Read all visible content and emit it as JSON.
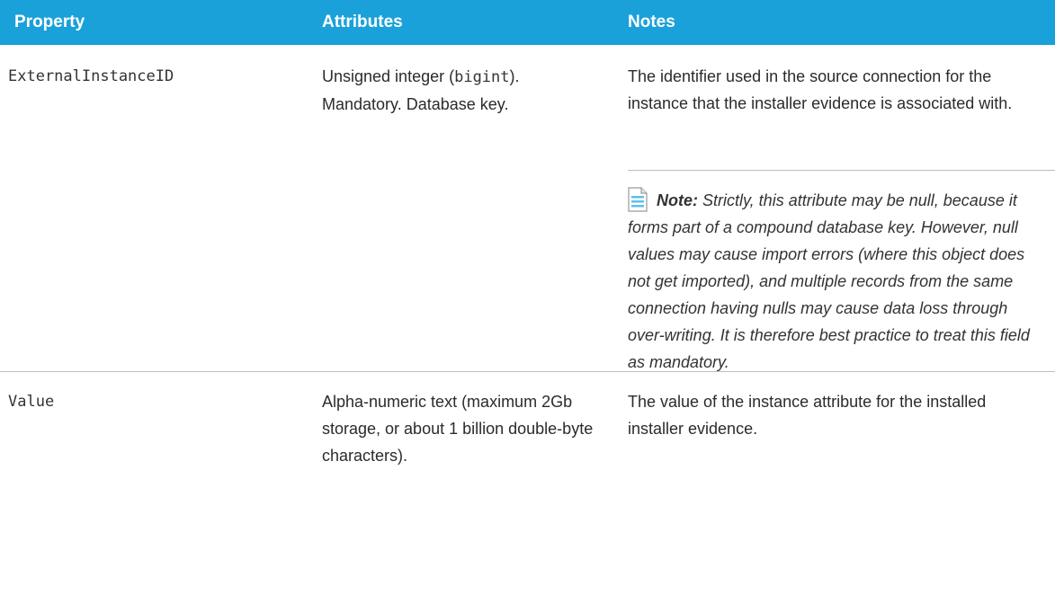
{
  "header": {
    "property": "Property",
    "attributes": "Attributes",
    "notes": "Notes"
  },
  "rows": [
    {
      "property": "ExternalInstanceID",
      "attributes": {
        "before": "Unsigned integer (",
        "code": "bigint",
        "after": "). Mandatory. Database key."
      },
      "notes": "The identifier used in the source connection for the instance that the installer evidence is associated with.",
      "note": {
        "icon": "document-note-icon",
        "label": "Note:",
        "text": "Strictly, this attribute may be null, because it forms part of a compound database key. However, null values may cause import errors (where this object does not get imported), and multiple records from the same connection having nulls may cause data loss through over-writing. It is therefore best practice to treat this field as mandatory."
      }
    },
    {
      "property": "Value",
      "attributes": {
        "text": "Alpha-numeric text (maximum 2Gb storage, or about 1 billion double-byte characters)."
      },
      "notes": "The value of the instance attribute for the installed installer evidence."
    }
  ],
  "colors": {
    "header_bg": "#1ba1d9",
    "header_text": "#ffffff",
    "separator": "#bdbdbd"
  }
}
